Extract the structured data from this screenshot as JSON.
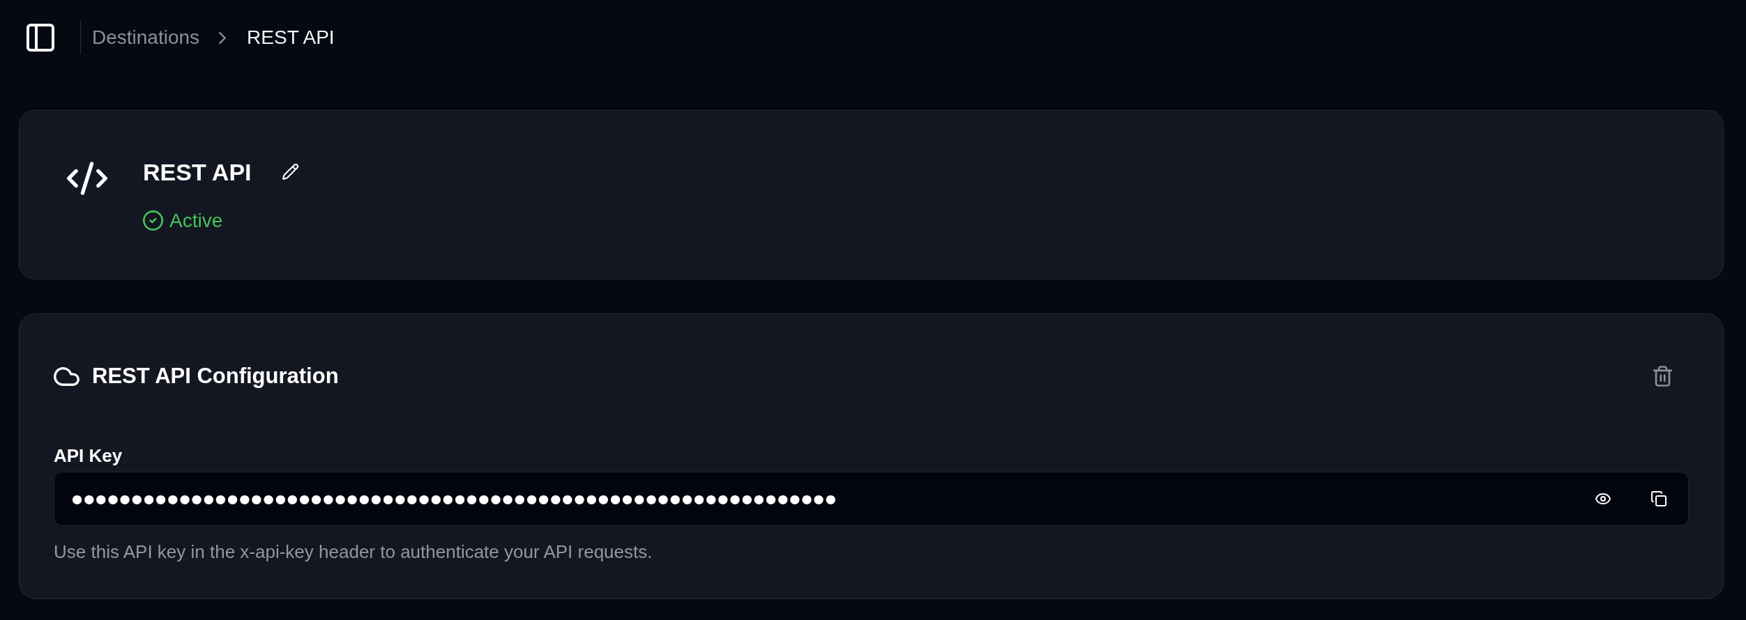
{
  "breadcrumb": [
    {
      "label": "Destinations",
      "current": false
    },
    {
      "label": "REST API",
      "current": true
    }
  ],
  "destination": {
    "title": "REST API",
    "status": {
      "kind": "active",
      "label": "Active"
    }
  },
  "configuration": {
    "title": "REST API Configuration",
    "fields": [
      {
        "label": "API Key",
        "value": "••••••••••••••••••••••••••••••••••••••••••••••••••••••••••••••••",
        "help": "Use this API key in the x-api-key header to authenticate your API requests."
      }
    ]
  }
}
